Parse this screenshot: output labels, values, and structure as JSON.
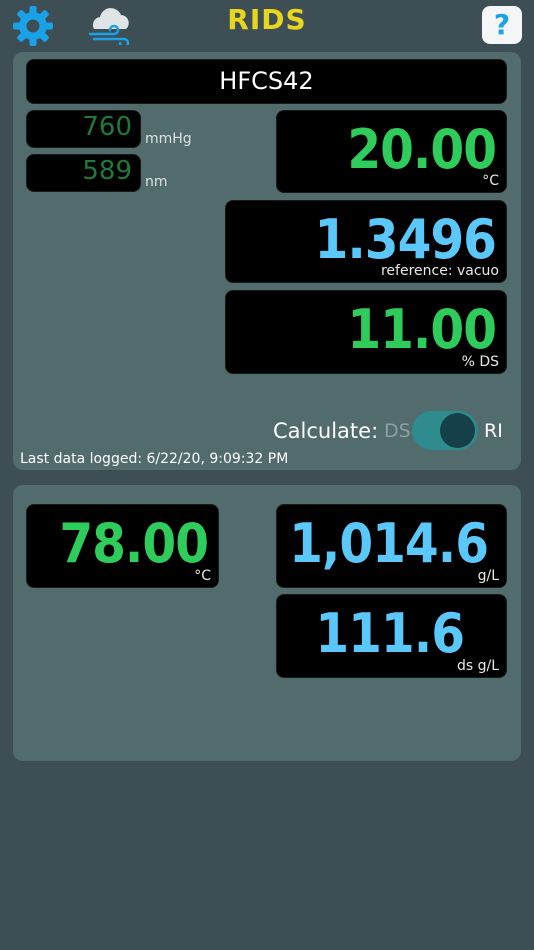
{
  "header": {
    "title": "RIDS",
    "settings_icon": "gear-icon",
    "weather_icon": "cloud-wind-icon",
    "help_label": "?"
  },
  "colors": {
    "title": "#e8d51e",
    "accent_blue": "#1aa2e8",
    "value_green": "#2ecc5a",
    "value_blue": "#5ac8fa"
  },
  "top": {
    "product": "HFCS42",
    "pressure": {
      "value": "760",
      "unit": "mmHg"
    },
    "wavelength": {
      "value": "589",
      "unit": "nm"
    },
    "temperature": {
      "value": "20.00",
      "unit": "°C"
    },
    "refractive_index": {
      "value": "1.3496",
      "unit": "reference:  vacuo"
    },
    "dissolved_solids": {
      "value": "11.00",
      "unit": "% DS"
    },
    "calculate_label": "Calculate:",
    "toggle_left": "DS",
    "toggle_right": "RI",
    "toggle_selected": "RI",
    "last_logged": "Last data logged:  6/22/20, 9:09:32 PM"
  },
  "bottom": {
    "temperature": {
      "value": "78.00",
      "unit": "°C"
    },
    "density": {
      "value": "1,014.6",
      "unit": "g/L"
    },
    "ds_density": {
      "value": "111.6",
      "unit": "ds g/L"
    }
  }
}
